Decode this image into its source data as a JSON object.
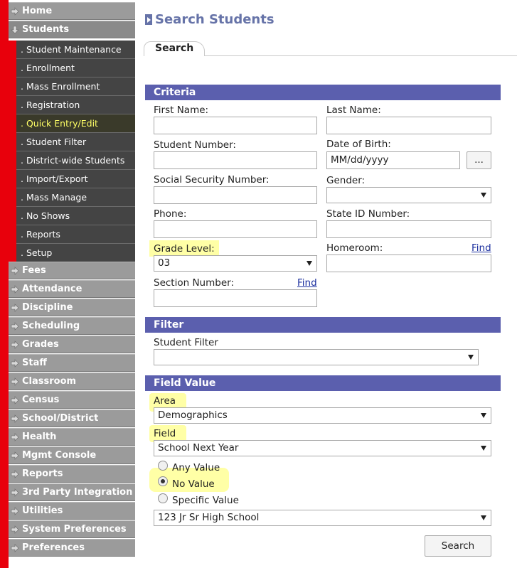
{
  "sidebar": {
    "top_items": [
      {
        "label": "Home"
      },
      {
        "label": "Students"
      }
    ],
    "sub_items": [
      {
        "label": ". Student Maintenance"
      },
      {
        "label": ". Enrollment"
      },
      {
        "label": ". Mass Enrollment"
      },
      {
        "label": ". Registration"
      },
      {
        "label": ". Quick Entry/Edit"
      },
      {
        "label": ". Student Filter"
      },
      {
        "label": ". District-wide Students"
      },
      {
        "label": ". Import/Export"
      },
      {
        "label": ". Mass Manage"
      },
      {
        "label": ". No Shows"
      },
      {
        "label": ". Reports"
      },
      {
        "label": ". Setup"
      }
    ],
    "bottom_items": [
      {
        "label": "Fees"
      },
      {
        "label": "Attendance"
      },
      {
        "label": "Discipline"
      },
      {
        "label": "Scheduling"
      },
      {
        "label": "Grades"
      },
      {
        "label": "Staff"
      },
      {
        "label": "Classroom"
      },
      {
        "label": "Census"
      },
      {
        "label": "School/District"
      },
      {
        "label": "Health"
      },
      {
        "label": "Mgmt Console"
      },
      {
        "label": "Reports"
      },
      {
        "label": "3rd Party Integration"
      },
      {
        "label": "Utilities"
      },
      {
        "label": "System Preferences"
      },
      {
        "label": "Preferences"
      }
    ]
  },
  "page": {
    "title": "Search Students",
    "tab": "Search"
  },
  "criteria": {
    "header": "Criteria",
    "first_name_label": "First Name:",
    "last_name_label": "Last Name:",
    "student_number_label": "Student Number:",
    "dob_label": "Date of Birth:",
    "dob_value": "MM/dd/yyyy",
    "dob_button": "...",
    "ssn_label": "Social Security Number:",
    "gender_label": "Gender:",
    "phone_label": "Phone:",
    "state_id_label": "State ID Number:",
    "grade_level_label": "Grade Level:",
    "grade_level_value": "03",
    "homeroom_label": "Homeroom:",
    "find_label": "Find",
    "section_number_label": "Section Number:"
  },
  "filter": {
    "header": "Filter",
    "student_filter_label": "Student Filter"
  },
  "field_value": {
    "header": "Field Value",
    "area_label": "Area",
    "area_value": "Demographics",
    "field_label": "Field",
    "field_value": "School Next Year",
    "options": [
      "Any Value",
      "No Value",
      "Specific Value"
    ],
    "selected_option": "No Value",
    "specific_value": "123 Jr Sr High School"
  },
  "search_button": "Search",
  "colors": {
    "sidebar_red": "#e8000c",
    "section_header": "#5b5fae",
    "title": "#6673a8",
    "highlight": "#ffff66"
  }
}
